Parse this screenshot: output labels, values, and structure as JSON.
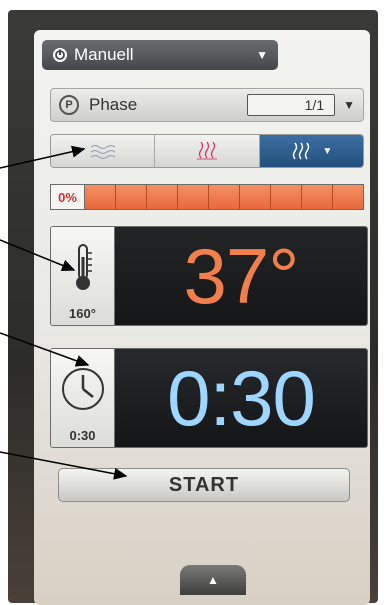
{
  "header": {
    "title": "Manuell"
  },
  "phase": {
    "label": "Phase",
    "counter": "1/1"
  },
  "humidity": {
    "percent_label": "0%",
    "level": 0
  },
  "temperature": {
    "value": "37°",
    "setpoint": "160°"
  },
  "time": {
    "value": "0:30",
    "setpoint": "0:30"
  },
  "start": {
    "label": "START"
  },
  "colors": {
    "temp_accent": "#f07f4c",
    "time_accent": "#9fd6ff",
    "active_mode": "#2d5f8f"
  },
  "icons": [
    "power-icon",
    "program-p-icon",
    "steam-icon",
    "combi-icon",
    "hot-air-icon",
    "thermometer-icon",
    "clock-icon",
    "chevron-up-icon"
  ]
}
